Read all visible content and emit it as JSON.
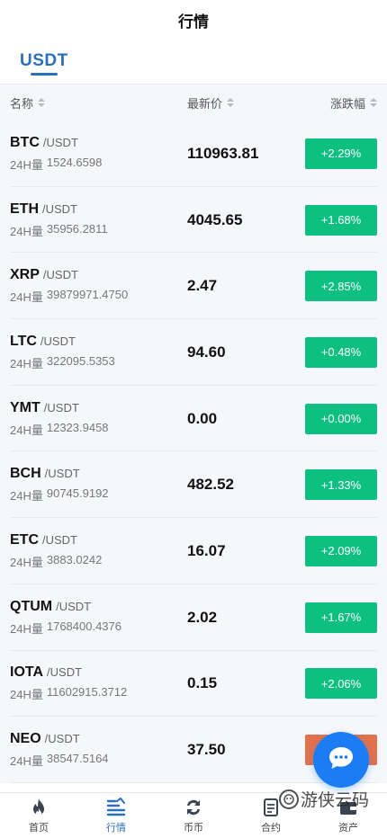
{
  "header": {
    "title": "行情"
  },
  "tabs": [
    {
      "label": "USDT",
      "active": true
    }
  ],
  "columns": {
    "name": "名称",
    "price": "最新价",
    "change": "涨跌幅"
  },
  "rows": [
    {
      "symbol": "BTC",
      "quote": "/USDT",
      "vol_label": "24H量",
      "volume": "1524.6598",
      "price": "110963.81",
      "change": "+2.29%"
    },
    {
      "symbol": "ETH",
      "quote": "/USDT",
      "vol_label": "24H量",
      "volume": "35956.2811",
      "price": "4045.65",
      "change": "+1.68%"
    },
    {
      "symbol": "XRP",
      "quote": "/USDT",
      "vol_label": "24H量",
      "volume": "39879971.4750",
      "price": "2.47",
      "change": "+2.85%"
    },
    {
      "symbol": "LTC",
      "quote": "/USDT",
      "vol_label": "24H量",
      "volume": "322095.5353",
      "price": "94.60",
      "change": "+0.48%"
    },
    {
      "symbol": "YMT",
      "quote": "/USDT",
      "vol_label": "24H量",
      "volume": "12323.9458",
      "price": "0.00",
      "change": "+0.00%"
    },
    {
      "symbol": "BCH",
      "quote": "/USDT",
      "vol_label": "24H量",
      "volume": "90745.9192",
      "price": "482.52",
      "change": "+1.33%"
    },
    {
      "symbol": "ETC",
      "quote": "/USDT",
      "vol_label": "24H量",
      "volume": "3883.0242",
      "price": "16.07",
      "change": "+2.09%"
    },
    {
      "symbol": "QTUM",
      "quote": "/USDT",
      "vol_label": "24H量",
      "volume": "1768400.4376",
      "price": "2.02",
      "change": "+1.67%"
    },
    {
      "symbol": "IOTA",
      "quote": "/USDT",
      "vol_label": "24H量",
      "volume": "11602915.3712",
      "price": "0.15",
      "change": "+2.06%"
    },
    {
      "symbol": "NEO",
      "quote": "/USDT",
      "vol_label": "24H量",
      "volume": "38547.5164",
      "price": "37.50",
      "change": ""
    }
  ],
  "colors": {
    "accent": "#2d6fb7",
    "up": "#0ebf82",
    "down": "#e2714e",
    "fab": "#1c7cf4"
  },
  "tabbar": [
    {
      "label": "首页",
      "icon": "flame-icon"
    },
    {
      "label": "行情",
      "icon": "market-icon",
      "active": true
    },
    {
      "label": "币币",
      "icon": "exchange-icon"
    },
    {
      "label": "合约",
      "icon": "contract-icon"
    },
    {
      "label": "资产",
      "icon": "wallet-icon"
    }
  ],
  "fab": {
    "icon": "chat-icon"
  },
  "watermark": {
    "text": "游侠云码"
  }
}
